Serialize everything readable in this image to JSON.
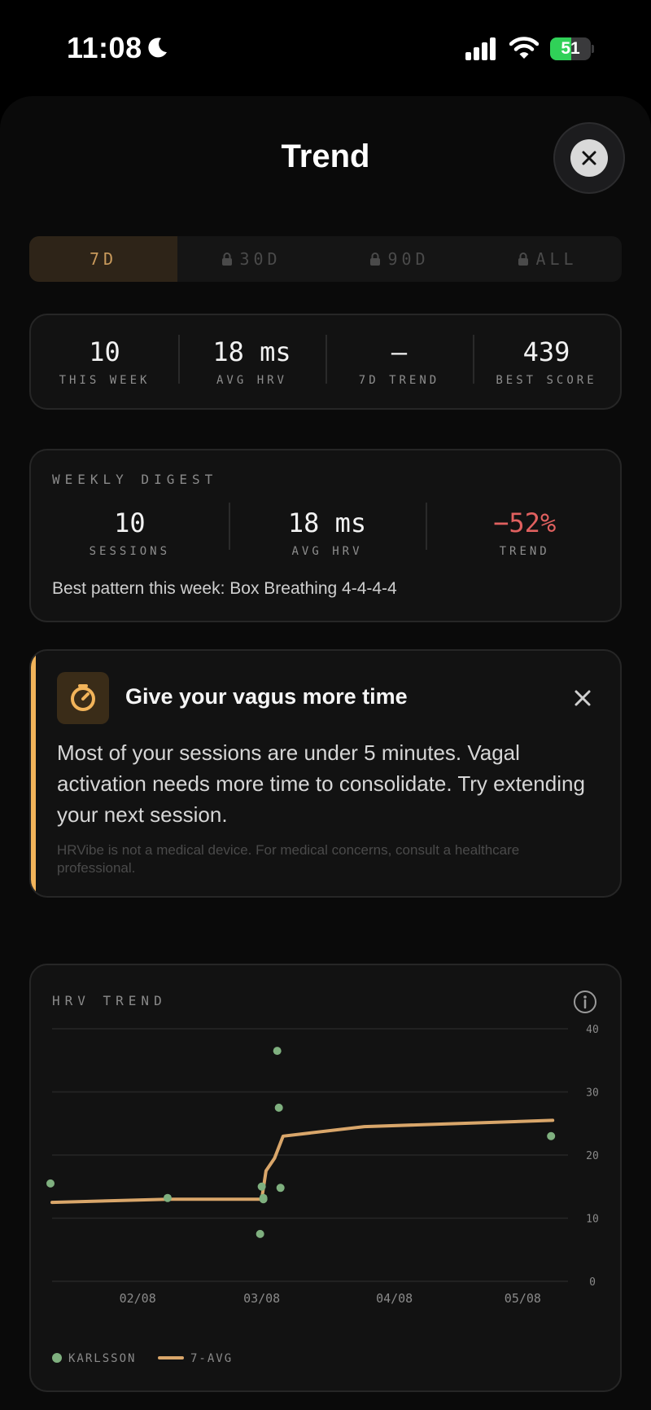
{
  "status_bar": {
    "time": "11:08",
    "battery": 51
  },
  "sheet": {
    "title": "Trend"
  },
  "range_tabs": [
    {
      "label": "7D",
      "locked": false,
      "active": true
    },
    {
      "label": "30D",
      "locked": true,
      "active": false
    },
    {
      "label": "90D",
      "locked": true,
      "active": false
    },
    {
      "label": "ALL",
      "locked": true,
      "active": false
    }
  ],
  "summary": [
    {
      "value": "10",
      "label": "THIS WEEK"
    },
    {
      "value": "18 ms",
      "label": "AVG HRV"
    },
    {
      "value": "—",
      "label": "7D TREND"
    },
    {
      "value": "439",
      "label": "BEST SCORE"
    }
  ],
  "digest": {
    "title": "WEEKLY DIGEST",
    "stats": [
      {
        "value": "10",
        "label": "SESSIONS"
      },
      {
        "value": "18 ms",
        "label": "AVG HRV"
      },
      {
        "value": "−52%",
        "label": "TREND"
      }
    ],
    "best_pattern": "Best pattern this week: Box Breathing 4-4-4-4"
  },
  "tip": {
    "title": "Give your vagus more time",
    "body": "Most of your sessions are under 5 minutes. Vagal activation needs more time to consolidate. Try extending your next session.",
    "disclaimer": "HRVibe is not a medical device. For medical concerns, consult a healthcare professional.",
    "accent_color": "#f2b45a"
  },
  "chart": {
    "title": "HRV TREND",
    "colors": {
      "points": "#7fb07f",
      "line": "#d9a66a"
    }
  },
  "chart_data": {
    "type": "scatter",
    "title": "HRV TREND",
    "xlabel": "",
    "ylabel": "",
    "x_ticks": [
      "02/08",
      "03/08",
      "04/08",
      "05/08"
    ],
    "y_ticks": [
      0,
      10,
      20,
      30,
      40
    ],
    "ylim": [
      0,
      40
    ],
    "grid": true,
    "legend_position": "bottom-left",
    "series": [
      {
        "name": "KARLSSON",
        "kind": "points",
        "points": [
          [
            "01/19",
            15.5
          ],
          [
            "02/15",
            13.2
          ],
          [
            "03/08",
            13.2
          ],
          [
            "03/08",
            7.5
          ],
          [
            "03/08",
            15
          ],
          [
            "03/08",
            13
          ],
          [
            "03/12",
            36.5
          ],
          [
            "03/12",
            27.5
          ],
          [
            "03/12",
            14.8
          ],
          [
            "05/15",
            23
          ]
        ]
      },
      {
        "name": "7-AVG",
        "kind": "line",
        "points": [
          [
            "01/19",
            12.5
          ],
          [
            "02/15",
            13
          ],
          [
            "03/08",
            13
          ],
          [
            "03/09",
            17.5
          ],
          [
            "03/11",
            19.5
          ],
          [
            "03/13",
            23
          ],
          [
            "04/01",
            24.5
          ],
          [
            "05/15",
            25.5
          ]
        ]
      }
    ]
  }
}
